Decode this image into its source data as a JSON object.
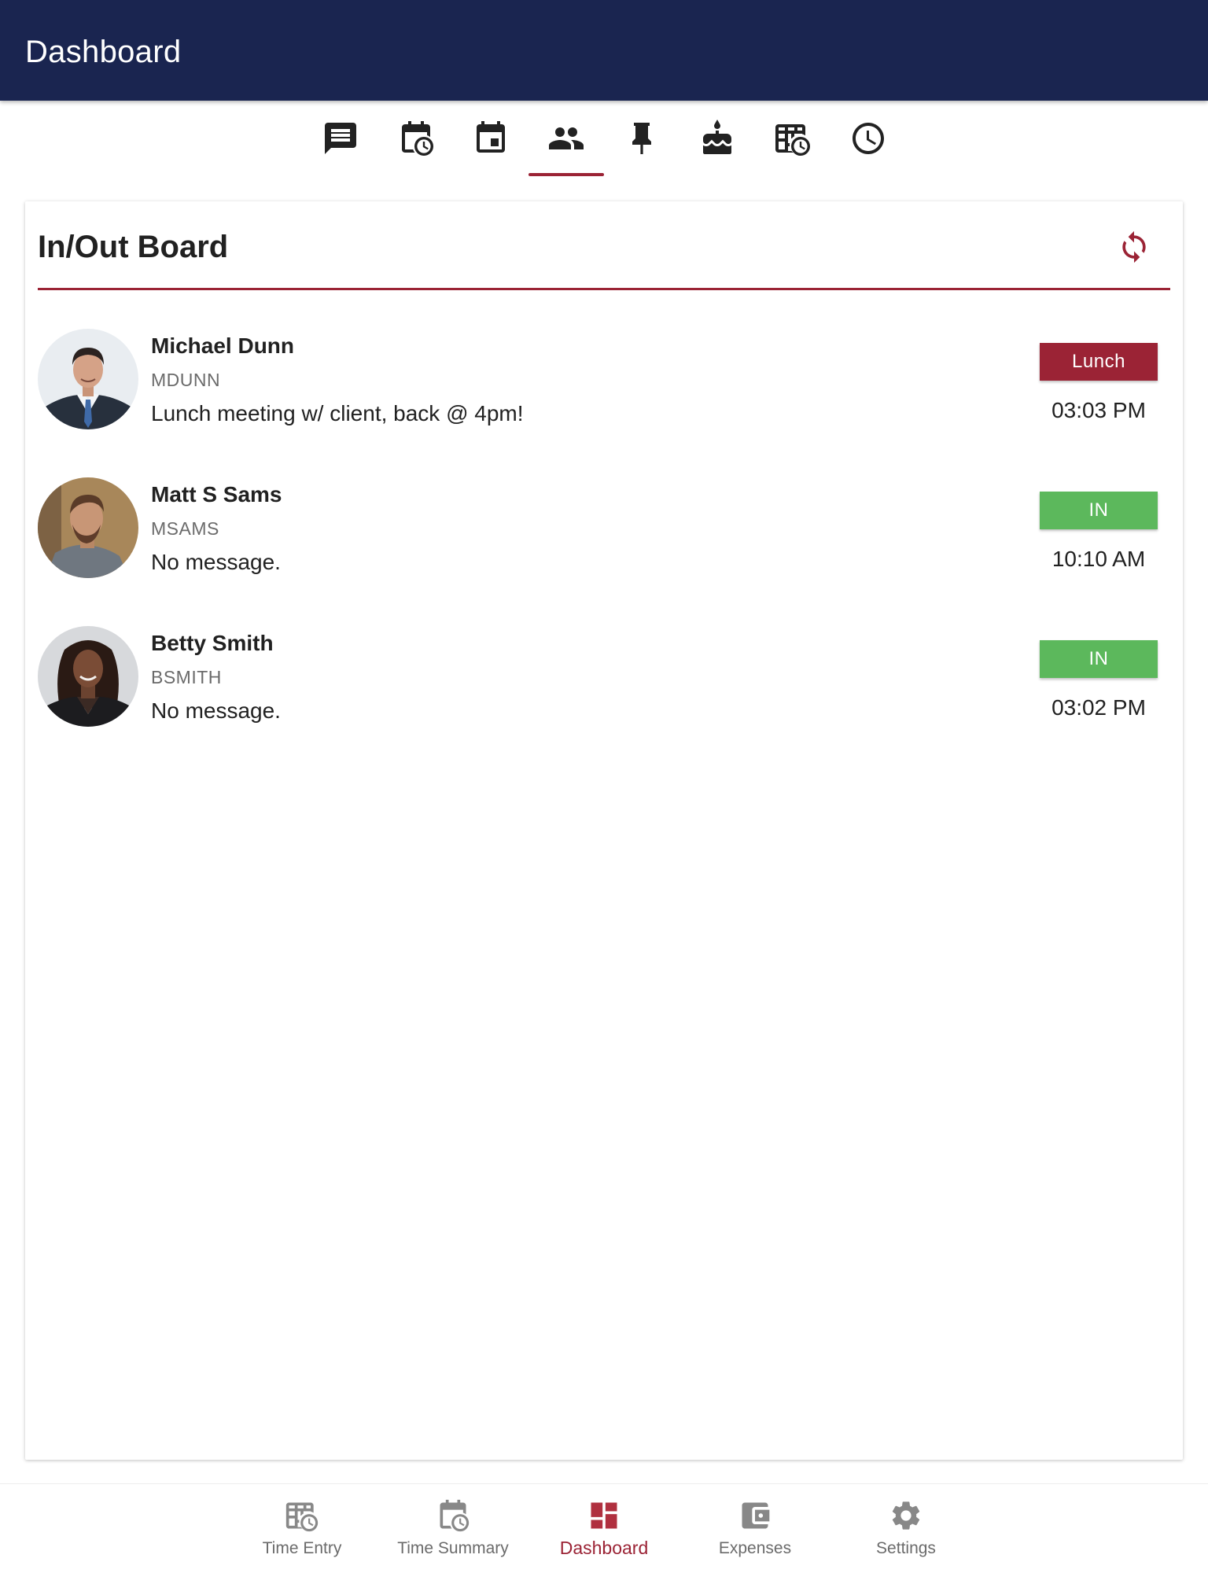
{
  "app_bar": {
    "title": "Dashboard"
  },
  "tabs": [
    {
      "icon": "message-icon",
      "active": false
    },
    {
      "icon": "calendar-clock-icon",
      "active": false
    },
    {
      "icon": "calendar-event-icon",
      "active": false
    },
    {
      "icon": "people-icon",
      "active": true
    },
    {
      "icon": "pin-icon",
      "active": false
    },
    {
      "icon": "cake-icon",
      "active": false
    },
    {
      "icon": "timesheet-icon",
      "active": false
    },
    {
      "icon": "clock-icon",
      "active": false
    }
  ],
  "board": {
    "title": "In/Out Board",
    "refresh_icon": "refresh-icon",
    "people": [
      {
        "name": "Michael Dunn",
        "username": "MDUNN",
        "message": "Lunch meeting w/ client, back @ 4pm!",
        "status": "Lunch",
        "status_color": "#9b2335",
        "time": "03:03 PM"
      },
      {
        "name": "Matt S Sams",
        "username": "MSAMS",
        "message": "No message.",
        "status": "IN",
        "status_color": "#5cb85c",
        "time": "10:10 AM"
      },
      {
        "name": "Betty Smith",
        "username": "BSMITH",
        "message": "No message.",
        "status": "IN",
        "status_color": "#5cb85c",
        "time": "03:02 PM"
      }
    ]
  },
  "bottom_nav": [
    {
      "label": "Time Entry",
      "icon": "timesheet-icon",
      "active": false
    },
    {
      "label": "Time Summary",
      "icon": "calendar-clock-icon",
      "active": false
    },
    {
      "label": "Dashboard",
      "icon": "dashboard-icon",
      "active": true
    },
    {
      "label": "Expenses",
      "icon": "wallet-icon",
      "active": false
    },
    {
      "label": "Settings",
      "icon": "gear-icon",
      "active": false
    }
  ],
  "colors": {
    "app_bar": "#1a2550",
    "accent": "#9b2335",
    "in": "#5cb85c"
  }
}
